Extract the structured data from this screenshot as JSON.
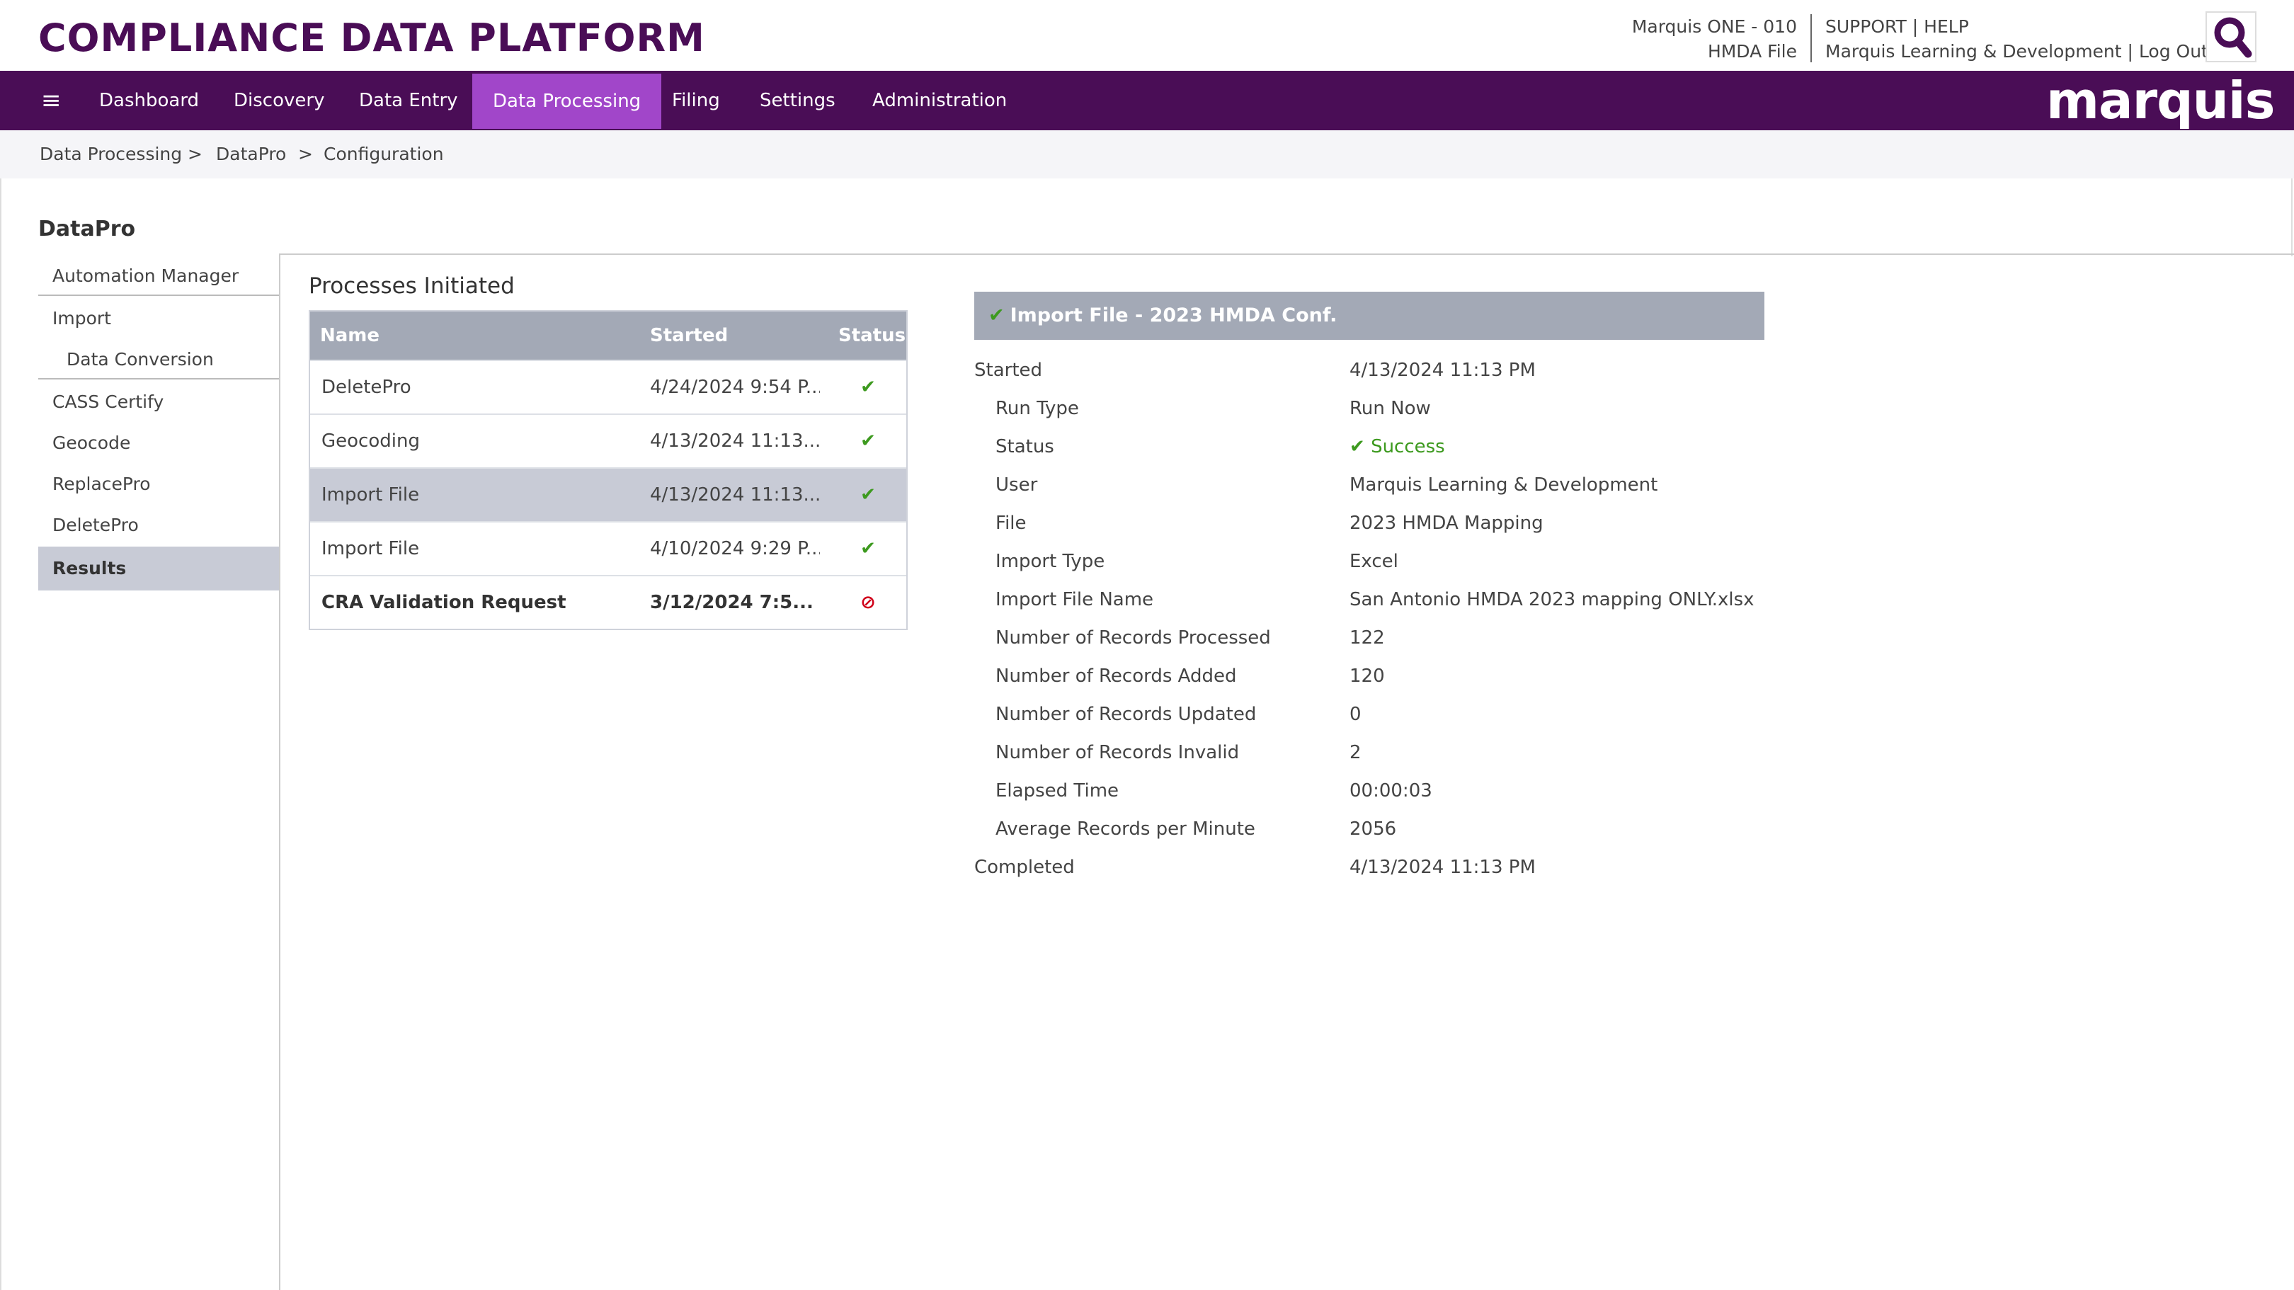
{
  "header": {
    "app_title": "COMPLIANCE DATA PLATFORM",
    "account_line1": "Marquis ONE - 010",
    "account_line2": "HMDA File",
    "support_label": "SUPPORT",
    "help_label": "HELP",
    "user_name": "Marquis Learning & Development",
    "logout_label": "Log Out",
    "separator": "|"
  },
  "nav": {
    "menu_glyph": "≡",
    "items": [
      {
        "label": "Dashboard"
      },
      {
        "label": "Discovery"
      },
      {
        "label": "Data Entry"
      },
      {
        "label": "Data Processing"
      },
      {
        "label": "Filing"
      },
      {
        "label": "Settings"
      },
      {
        "label": "Administration"
      }
    ],
    "active": "Data Processing",
    "brand": "marquis"
  },
  "breadcrumb": {
    "items": [
      "Data Processing",
      "DataPro",
      "Configuration"
    ],
    "separator": ">"
  },
  "sidebar": {
    "title": "DataPro",
    "items": [
      {
        "label": "Automation Manager"
      },
      {
        "label": "Import"
      },
      {
        "label": "Data Conversion"
      },
      {
        "label": "CASS Certify"
      },
      {
        "label": "Geocode"
      },
      {
        "label": "ReplacePro"
      },
      {
        "label": "DeletePro"
      },
      {
        "label": "Results"
      }
    ],
    "active": "Results"
  },
  "processes": {
    "title": "Processes Initiated",
    "columns": [
      "Name",
      "Started",
      "Status"
    ],
    "rows": [
      {
        "name": "DeletePro",
        "started": "4/24/2024 9:54 P...",
        "status": "success",
        "status_glyph": "✔"
      },
      {
        "name": "Geocoding",
        "started": "4/13/2024 11:13...",
        "status": "success",
        "status_glyph": "✔"
      },
      {
        "name": "Import File",
        "started": "4/13/2024 11:13...",
        "status": "success",
        "status_glyph": "✔"
      },
      {
        "name": "Import File",
        "started": "4/10/2024 9:29 P...",
        "status": "success",
        "status_glyph": "✔"
      },
      {
        "name": "CRA Validation Request",
        "started": "3/12/2024 7:5...",
        "status": "failed",
        "status_glyph": "⊘"
      }
    ],
    "selected_row": 2
  },
  "detail": {
    "title": "Import File - 2023 HMDA Conf.",
    "title_glyph": "✔",
    "fields": [
      {
        "label": "Started",
        "value": "4/13/2024 11:13 PM"
      },
      {
        "label": "Run Type",
        "value": "Run Now"
      },
      {
        "label": "Status",
        "value": "Success"
      },
      {
        "label": "User",
        "value": "Marquis Learning & Development"
      },
      {
        "label": "File",
        "value": "2023 HMDA Mapping"
      },
      {
        "label": "Import Type",
        "value": "Excel"
      },
      {
        "label": "Import File Name",
        "value": "San Antonio HMDA 2023 mapping ONLY.xlsx"
      },
      {
        "label": "Number of Records Processed",
        "value": "122"
      },
      {
        "label": "Number of Records Added",
        "value": "120"
      },
      {
        "label": "Number of Records Updated",
        "value": "0"
      },
      {
        "label": "Number of Records Invalid",
        "value": "2"
      },
      {
        "label": "Elapsed Time",
        "value": "00:00:03"
      },
      {
        "label": "Average Records per Minute",
        "value": "2056"
      },
      {
        "label": "Completed",
        "value": "4/13/2024 11:13 PM"
      }
    ],
    "status_glyph": "✔"
  },
  "colors": {
    "brand_purple": "#4a0d56",
    "nav_active": "#a146c9",
    "table_header": "#a3a9b6",
    "selected_row": "#c8cbd6",
    "success_green": "#3d9a1f",
    "error_red": "#d0021b"
  }
}
